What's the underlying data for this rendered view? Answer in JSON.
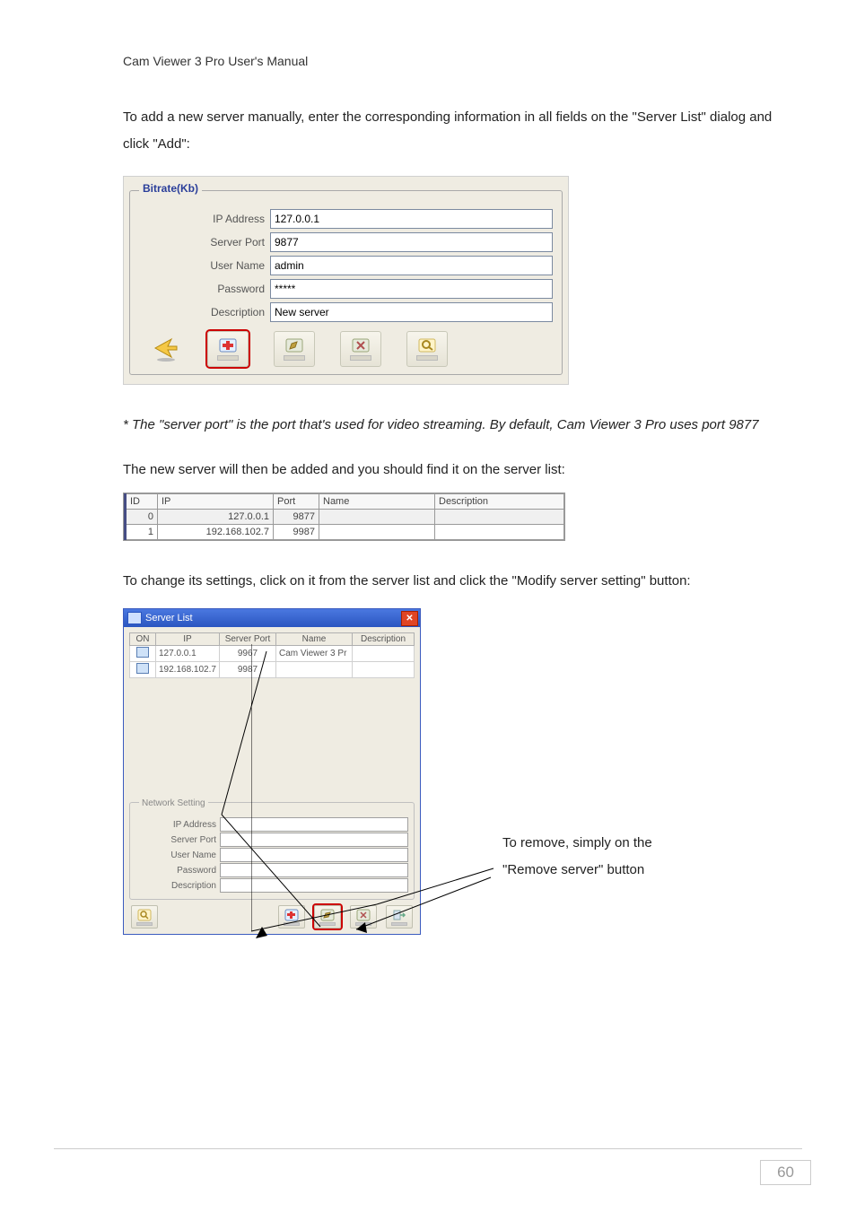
{
  "header": "Cam Viewer  3  Pro  User's  Manual",
  "intro": "To add a new server manually, enter the corresponding information in all fields on the \"Server List\" dialog and click \"Add\":",
  "fieldset": {
    "legend": "Bitrate(Kb)",
    "rows": {
      "ip_label": "IP Address",
      "ip_value": "127.0.0.1",
      "port_label": "Server Port",
      "port_value": "9877",
      "user_label": "User Name",
      "user_value": "admin",
      "pass_label": "Password",
      "pass_value": "*****",
      "desc_label": "Description",
      "desc_value": "New server"
    }
  },
  "note": "* The \"server port\" is the port that's used for video streaming. By default, Cam Viewer 3 Pro uses port 9877",
  "added_text": "The new server will then be added and you should find it on the server list:",
  "table": {
    "headers": {
      "id": "ID",
      "ip": "IP",
      "port": "Port",
      "name": "Name",
      "desc": "Description"
    },
    "rows": [
      {
        "id": "0",
        "ip": "127.0.0.1",
        "port": "9877",
        "name": "",
        "desc": ""
      },
      {
        "id": "1",
        "ip": "192.168.102.7",
        "port": "9987",
        "name": "",
        "desc": ""
      }
    ]
  },
  "modify_text": "To change its settings, click on it from the server list and click the \"Modify server setting\" button:",
  "window": {
    "title": "Server List",
    "cols": {
      "on": "ON",
      "ip": "IP",
      "port": "Server Port",
      "name": "Name",
      "desc": "Description"
    },
    "rows": [
      {
        "ip": "127.0.0.1",
        "port": "9967",
        "name": "Cam Viewer 3 Pr",
        "desc": ""
      },
      {
        "ip": "192.168.102.7",
        "port": "9987",
        "name": "",
        "desc": ""
      }
    ],
    "group": "Network Setting",
    "labels": {
      "ip": "IP Address",
      "port": "Server Port",
      "user": "User Name",
      "pass": "Password",
      "desc": "Description"
    }
  },
  "callout": "To remove, simply on the \"Remove server\" button",
  "page_num": "60"
}
